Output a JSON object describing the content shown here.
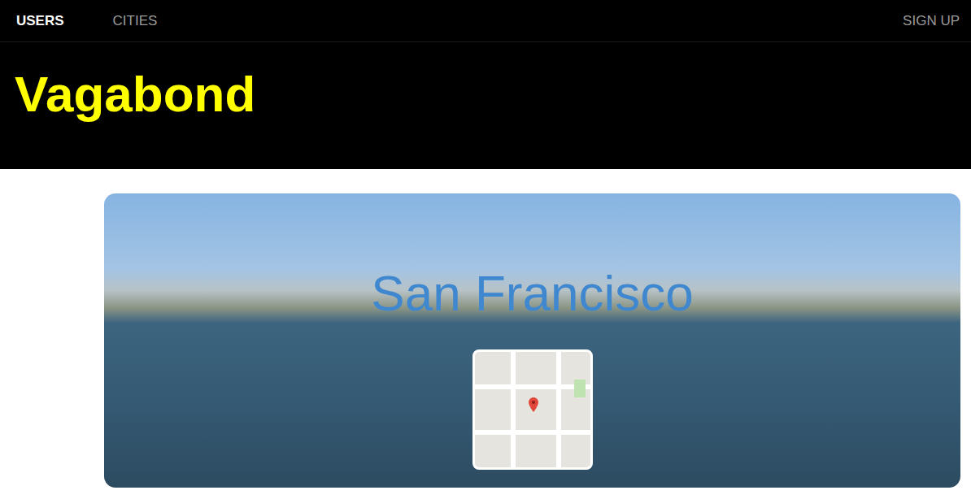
{
  "nav": {
    "items": [
      {
        "label": "USERS",
        "selected": true
      },
      {
        "label": "CITIES",
        "selected": false
      }
    ],
    "action": "SIGN UP"
  },
  "header": {
    "title": "Vagabond"
  },
  "city": {
    "name": "San Francisco"
  }
}
